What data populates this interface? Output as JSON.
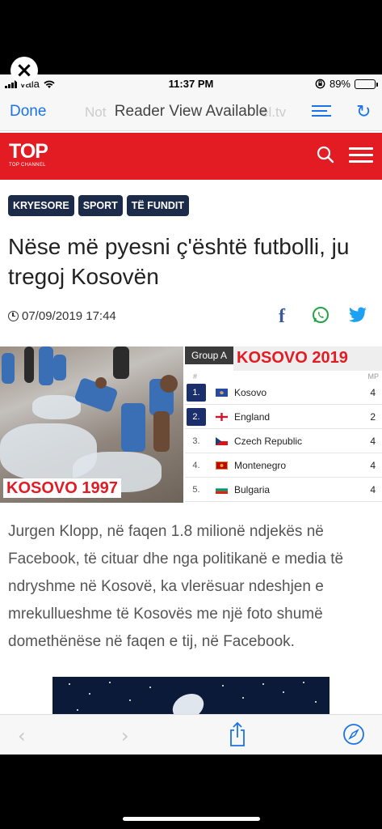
{
  "status": {
    "carrier": "vala",
    "time": "11:37 PM",
    "battery": "89%",
    "battery_level": 0.89
  },
  "browser": {
    "done_label": "Done",
    "page_title": "Reader View Available",
    "ghost_left": "Not",
    "ghost_right": "el.tv"
  },
  "site": {
    "logo_text": "TOP",
    "logo_sub": "TOP CHANNEL",
    "accent": "#e31b23",
    "tag_color": "#1c2b4a"
  },
  "article": {
    "tags": [
      "KRYESORE",
      "SPORT",
      "TË FUNDIT"
    ],
    "headline": "Nëse më pyesni ç'është futbolli, ju tregoj Kosovën",
    "datetime": "07/09/2019 17:44",
    "photo_caption": "KOSOVO 1997",
    "body": "Jurgen Klopp, në faqen 1.8 milionë ndjekës në Facebook, të cituar dhe nga politikanë e media të ndryshme në Kosovë, ka vlerësuar ndeshjen e mrekullueshme të Kosovës me një foto shumë domethënëse në faqen e tij, në Facebook."
  },
  "standings": {
    "group": "Group A",
    "title": "KOSOVO 2019",
    "col_pos": "#",
    "col_mp": "MP",
    "rows": [
      {
        "pos": "1.",
        "team": "Kosovo",
        "mp": "4"
      },
      {
        "pos": "2.",
        "team": "England",
        "mp": "2"
      },
      {
        "pos": "3.",
        "team": "Czech Republic",
        "mp": "4"
      },
      {
        "pos": "4.",
        "team": "Montenegro",
        "mp": "4"
      },
      {
        "pos": "5.",
        "team": "Bulgaria",
        "mp": "4"
      }
    ]
  },
  "icons": [
    "close-icon",
    "wifi-icon",
    "lock-rotation-icon",
    "reader-view-icon",
    "reload-icon",
    "search-icon",
    "menu-icon",
    "clock-icon",
    "facebook-icon",
    "whatsapp-icon",
    "twitter-icon",
    "back-icon",
    "forward-icon",
    "share-icon",
    "safari-compass-icon"
  ]
}
